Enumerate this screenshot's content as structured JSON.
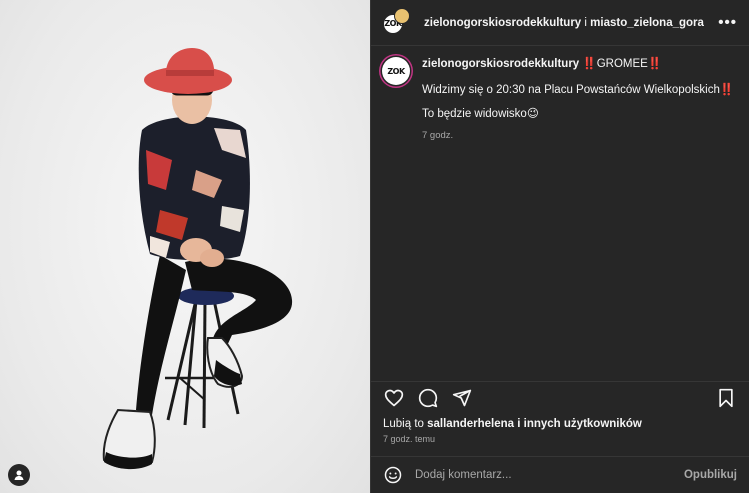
{
  "post": {
    "header": {
      "author": "zielonogorskiosrodekkultury",
      "connector": " i ",
      "coauthor": "miasto_zielona_gora",
      "more_icon": "more-horizontal-icon"
    },
    "avatar_logo": "ZOK",
    "caption": {
      "username": "zielonogorskiosrodekkultury",
      "title_prefix": "‼️",
      "title": "GROMEE",
      "title_suffix": "‼️",
      "line2": "Widzimy się o 20:30 na Placu Powstańców Wielkopolskich",
      "line2_suffix": "‼️",
      "line3": "To będzie widowisko",
      "line3_emoji": "😉",
      "time": "7 godz."
    },
    "actions": {
      "like_icon": "heart-icon",
      "comment_icon": "comment-icon",
      "share_icon": "share-icon",
      "save_icon": "bookmark-icon"
    },
    "likes": {
      "prefix": "Lubią to ",
      "user": "sallanderhelena",
      "suffix": " i innych użytkowników"
    },
    "post_time": "7 godz. temu",
    "comment": {
      "placeholder": "Dodaj komentarz...",
      "publish_label": "Opublikuj",
      "emoji_icon": "smiley-icon"
    },
    "media": {
      "user_tags_icon": "user-tag-icon"
    }
  }
}
